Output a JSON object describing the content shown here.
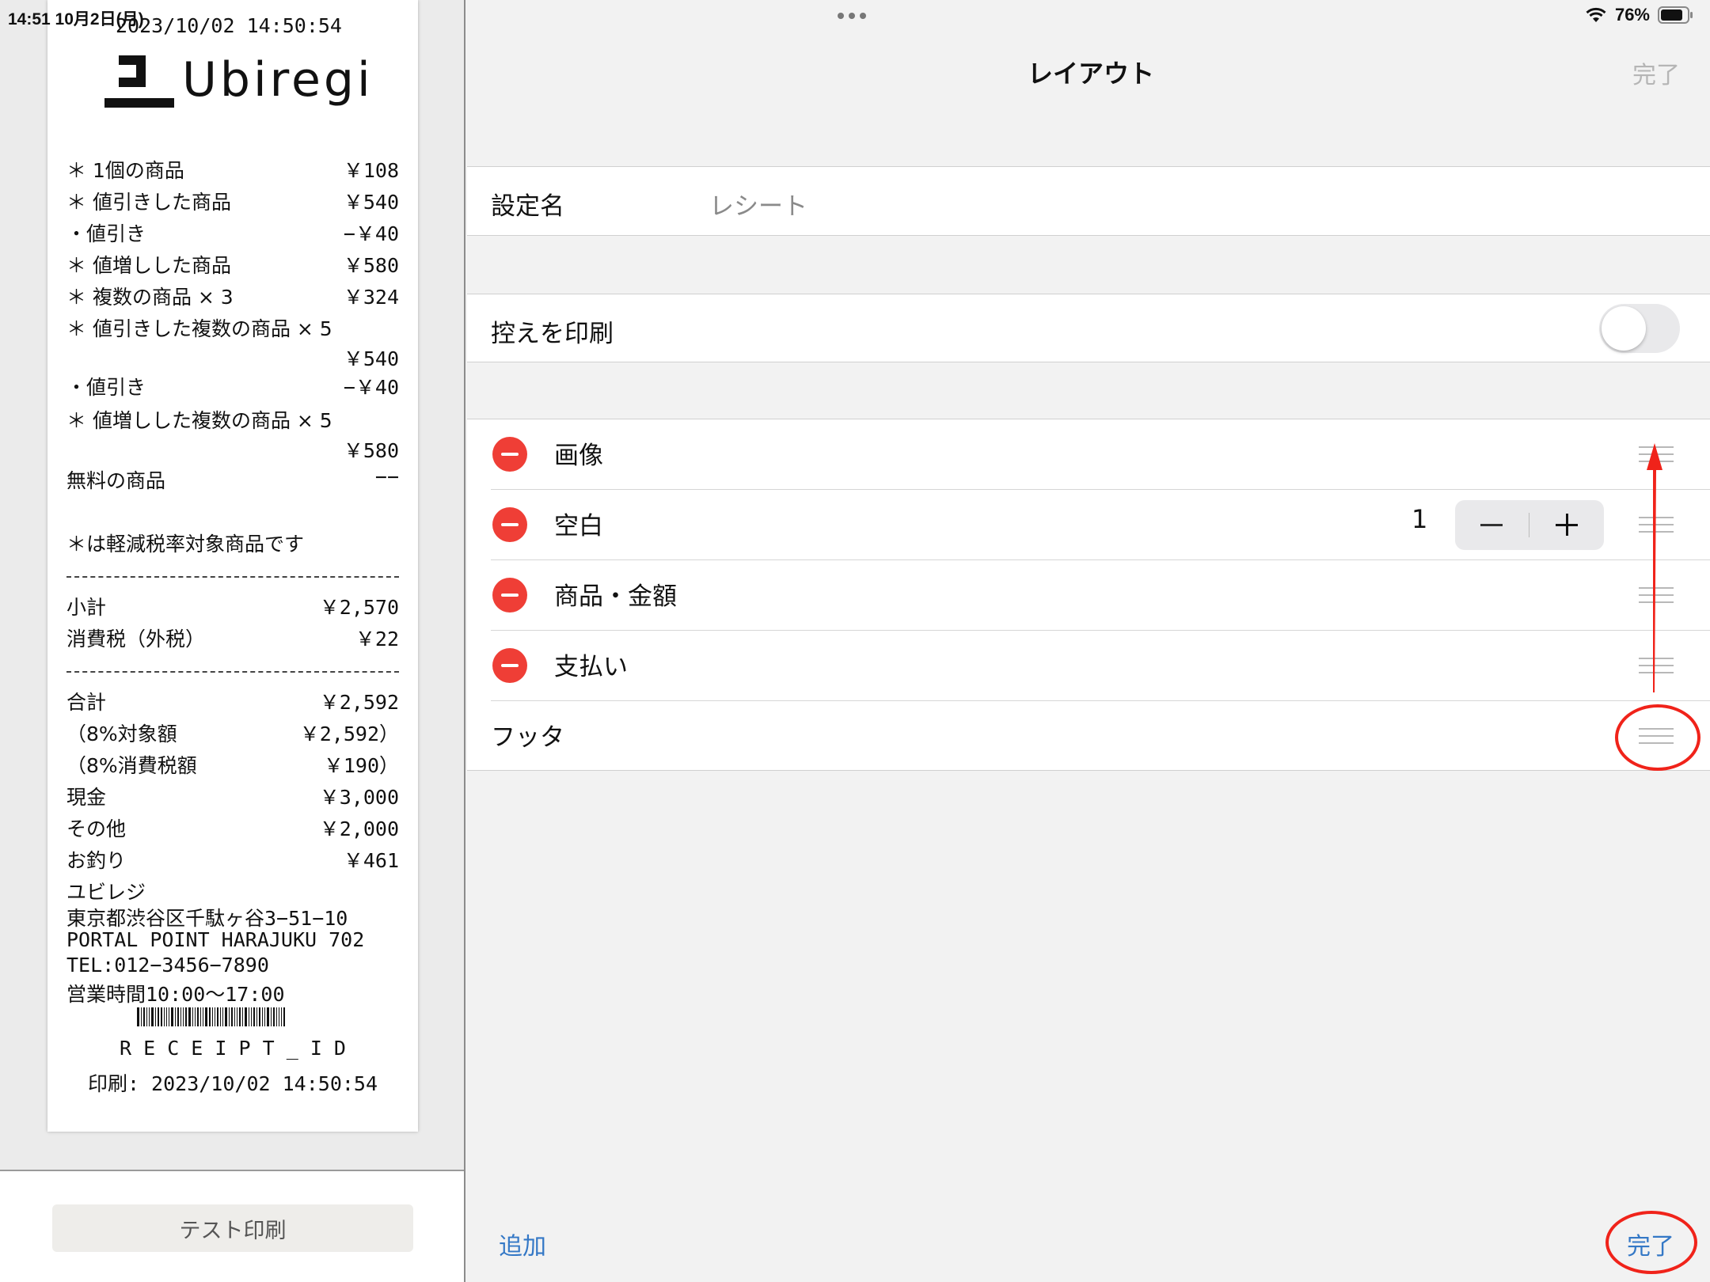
{
  "status_bar": {
    "time_date": "14:51  10月2日(月)",
    "battery": "76%",
    "wifi_icon": "wifi-icon",
    "battery_icon": "battery-icon"
  },
  "receipt": {
    "header_datetime": "2023/10/02 14:50:54",
    "logo_text": "Ubiregi",
    "items": [
      {
        "label": "＊ 1個の商品",
        "amount": "￥108"
      },
      {
        "label": "＊ 値引きした商品",
        "amount": "￥540"
      },
      {
        "label": "・値引き",
        "amount": "−￥40"
      },
      {
        "label": "＊ 値増しした商品",
        "amount": "￥580"
      },
      {
        "label": "＊ 複数の商品 × 3",
        "amount": "￥324"
      },
      {
        "label": "＊ 値引きした複数の商品 × 5",
        "amount": ""
      },
      {
        "label": "",
        "amount": "￥540"
      },
      {
        "label": "・値引き",
        "amount": "−￥40"
      },
      {
        "label": "＊ 値増しした複数の商品 × 5",
        "amount": ""
      },
      {
        "label": "",
        "amount": "￥580"
      },
      {
        "label": "無料の商品",
        "amount": "−−"
      }
    ],
    "reduced_tax_note": "＊は軽減税率対象商品です",
    "subtotals": [
      {
        "label": "小計",
        "amount": "￥2,570"
      },
      {
        "label": "消費税（外税）",
        "amount": "￥22"
      }
    ],
    "totals": [
      {
        "label": "合計",
        "amount": "￥2,592"
      },
      {
        "label": "（8%対象額",
        "amount": "￥2,592）"
      },
      {
        "label": "（8%消費税額",
        "amount": "￥190）"
      },
      {
        "label": "現金",
        "amount": "￥3,000"
      },
      {
        "label": "その他",
        "amount": "￥2,000"
      },
      {
        "label": "お釣り",
        "amount": "￥461"
      }
    ],
    "footer_lines": [
      "ユビレジ",
      "東京都渋谷区千駄ヶ谷3−51−10",
      "PORTAL POINT HARAJUKU 702",
      "TEL:012−3456−7890",
      "営業時間10:00〜17:00"
    ],
    "receipt_id": "R E C E I P T _ I D",
    "printed_at": "印刷: 2023/10/02 14:50:54"
  },
  "test_print_button": "テスト印刷",
  "nav": {
    "title": "レイアウト",
    "done_label": "完了"
  },
  "settings": {
    "name_label": "設定名",
    "name_value": "レシート",
    "copy_print_label": "控えを印刷",
    "copy_print_enabled": false
  },
  "layout_items": [
    {
      "label": "画像",
      "deletable": true
    },
    {
      "label": "空白",
      "deletable": true,
      "stepper_value": "1"
    },
    {
      "label": "商品・金額",
      "deletable": true
    },
    {
      "label": "支払い",
      "deletable": true
    },
    {
      "label": "フッタ",
      "deletable": false
    }
  ],
  "toolbar": {
    "add_label": "追加",
    "done_label": "完了"
  },
  "colors": {
    "accent": "#3478c6",
    "delete": "#ef3e36",
    "annotation": "#f0231a"
  }
}
